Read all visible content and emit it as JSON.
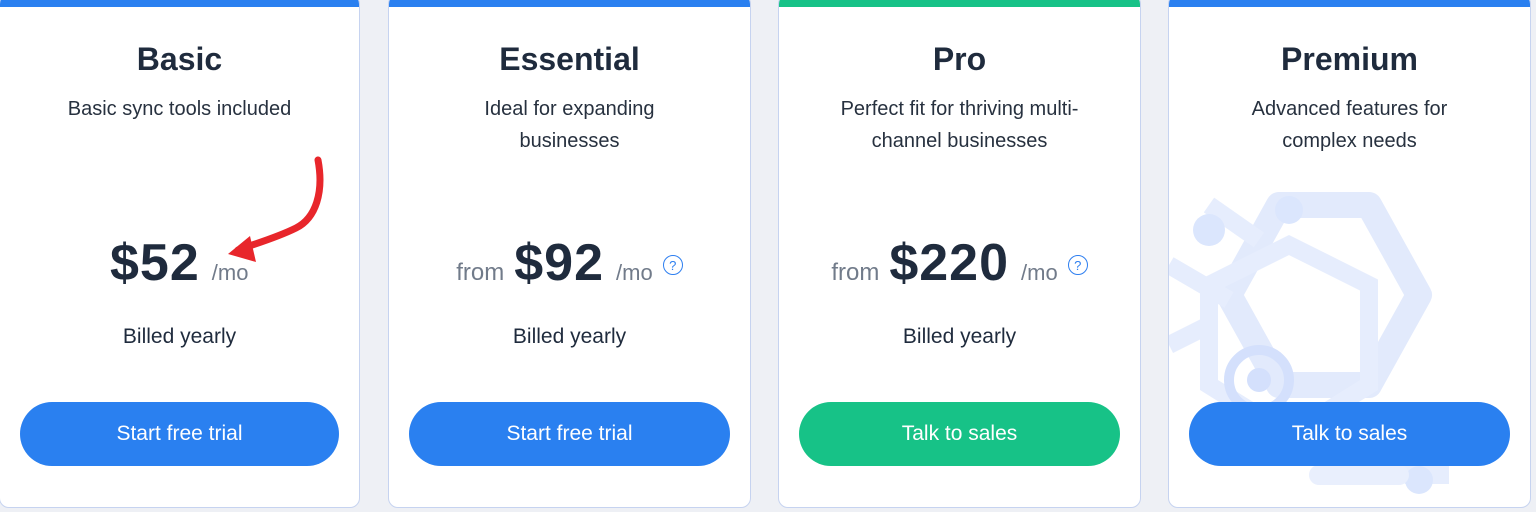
{
  "colors": {
    "blue": "#2a80f0",
    "green": "#17c287",
    "card_border": "#c6d3f0"
  },
  "plans": [
    {
      "title": "Basic",
      "subtitle_lines": [
        "Basic sync tools included"
      ],
      "price_prefix": "",
      "price": "$52",
      "period": "/mo",
      "billing": "Billed yearly",
      "cta_label": "Start free trial"
    },
    {
      "title": "Essential",
      "subtitle_lines": [
        "Ideal for expanding",
        "businesses"
      ],
      "price_prefix": "from",
      "price": "$92",
      "period": "/mo",
      "billing": "Billed yearly",
      "cta_label": "Start free trial"
    },
    {
      "title": "Pro",
      "subtitle_lines": [
        "Perfect fit for thriving multi-",
        "channel businesses"
      ],
      "price_prefix": "from",
      "price": "$220",
      "period": "/mo",
      "billing": "Billed yearly",
      "cta_label": "Talk to sales"
    },
    {
      "title": "Premium",
      "subtitle_lines": [
        "Advanced features for",
        "complex needs"
      ],
      "price_prefix": "",
      "price": "",
      "period": "",
      "billing": "",
      "cta_label": "Talk to sales"
    }
  ],
  "icons": {
    "help": "question-circle-icon",
    "annotation": "red-arrow"
  }
}
